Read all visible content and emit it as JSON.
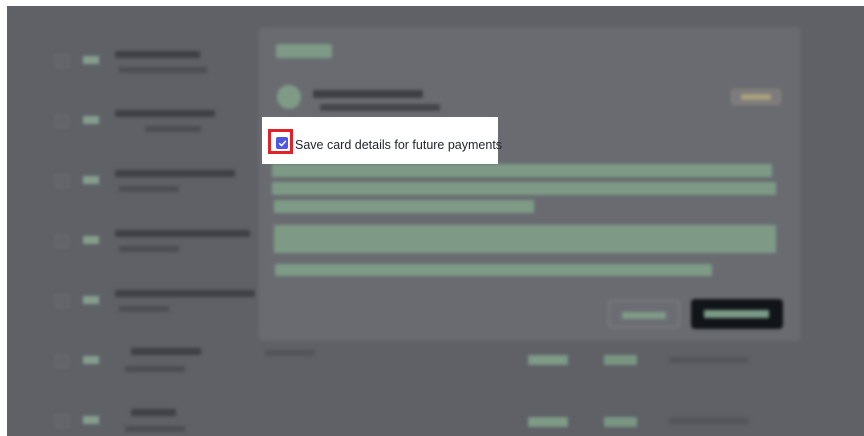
{
  "dialog": {
    "save_card_option": {
      "label": "Save card details for future payments",
      "checked": true
    }
  },
  "colors": {
    "overlay": "#5f6166",
    "accent_green": "#7e9a86",
    "checkbox_fill": "#4f56e2",
    "highlight_border": "#e0232a",
    "primary_button": "#111418"
  },
  "icons": {
    "checkbox": "checkmark-icon"
  }
}
